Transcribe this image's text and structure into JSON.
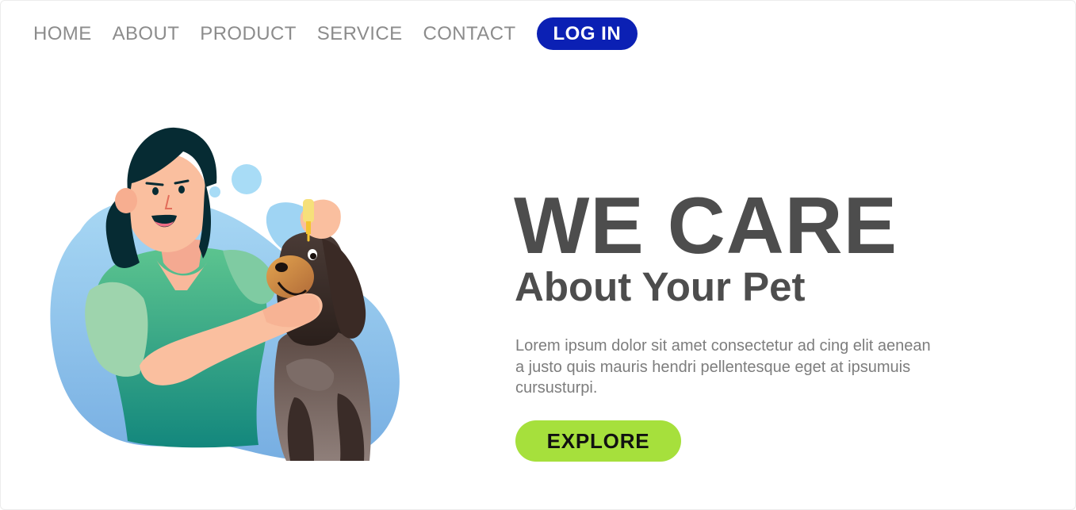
{
  "nav": {
    "items": [
      {
        "label": "HOME"
      },
      {
        "label": "ABOUT"
      },
      {
        "label": "PRODUCT"
      },
      {
        "label": "SERVICE"
      },
      {
        "label": "CONTACT"
      }
    ],
    "login_label": "LOG IN"
  },
  "hero": {
    "headline": "WE CARE",
    "subheadline": "About Your Pet",
    "body": "Lorem ipsum dolor sit amet consectetur ad cing elit aenean a justo quis mauris hendri pellentesque eget at ipsumuis cursusturpi.",
    "cta_label": "EXPLORE",
    "illustration": "woman-giving-eye-drops-to-dog-illustration"
  },
  "colors": {
    "login_bg": "#0b20b4",
    "cta_bg": "#a6e03c",
    "headline_text": "#4d4d4d",
    "nav_text": "#8c8c8c",
    "body_text": "#7d7d7d"
  }
}
